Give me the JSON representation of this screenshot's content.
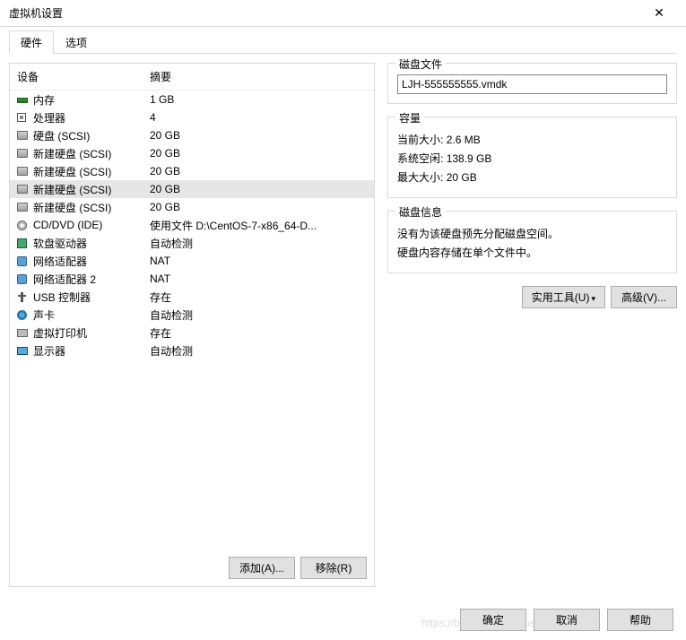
{
  "window": {
    "title": "虚拟机设置"
  },
  "tabs": {
    "hardware": "硬件",
    "options": "选项"
  },
  "headers": {
    "device": "设备",
    "summary": "摘要"
  },
  "devices": [
    {
      "icon": "mem",
      "name": "内存",
      "summary": "1 GB",
      "sel": false
    },
    {
      "icon": "cpu",
      "name": "处理器",
      "summary": "4",
      "sel": false
    },
    {
      "icon": "disk",
      "name": "硬盘 (SCSI)",
      "summary": "20 GB",
      "sel": false
    },
    {
      "icon": "disk",
      "name": "新建硬盘 (SCSI)",
      "summary": "20 GB",
      "sel": false
    },
    {
      "icon": "disk",
      "name": "新建硬盘 (SCSI)",
      "summary": "20 GB",
      "sel": false
    },
    {
      "icon": "disk",
      "name": "新建硬盘 (SCSI)",
      "summary": "20 GB",
      "sel": true
    },
    {
      "icon": "disk",
      "name": "新建硬盘 (SCSI)",
      "summary": "20 GB",
      "sel": false
    },
    {
      "icon": "cd",
      "name": "CD/DVD (IDE)",
      "summary": "使用文件 D:\\CentOS-7-x86_64-D...",
      "sel": false
    },
    {
      "icon": "floppy",
      "name": "软盘驱动器",
      "summary": "自动检测",
      "sel": false
    },
    {
      "icon": "net",
      "name": "网络适配器",
      "summary": "NAT",
      "sel": false
    },
    {
      "icon": "net",
      "name": "网络适配器 2",
      "summary": "NAT",
      "sel": false
    },
    {
      "icon": "usb",
      "name": "USB 控制器",
      "summary": "存在",
      "sel": false
    },
    {
      "icon": "snd",
      "name": "声卡",
      "summary": "自动检测",
      "sel": false
    },
    {
      "icon": "prn",
      "name": "虚拟打印机",
      "summary": "存在",
      "sel": false
    },
    {
      "icon": "disp",
      "name": "显示器",
      "summary": "自动检测",
      "sel": false
    }
  ],
  "buttons": {
    "add": "添加(A)...",
    "remove": "移除(R)",
    "utility": "实用工具(U)",
    "advanced": "高级(V)...",
    "ok": "确定",
    "cancel": "取消",
    "help": "帮助"
  },
  "diskFile": {
    "title": "磁盘文件",
    "value": "LJH-555555555.vmdk"
  },
  "capacity": {
    "title": "容量",
    "currentLabel": "当前大小:",
    "currentVal": "2.6 MB",
    "freeLabel": "系统空闲:",
    "freeVal": "138.9 GB",
    "maxLabel": "最大大小:",
    "maxVal": "20 GB"
  },
  "diskInfo": {
    "title": "磁盘信息",
    "line1": "没有为该硬盘预先分配磁盘空间。",
    "line2": "硬盘内容存储在单个文件中。"
  },
  "watermark": "https://blog.csdn.net/me blog"
}
